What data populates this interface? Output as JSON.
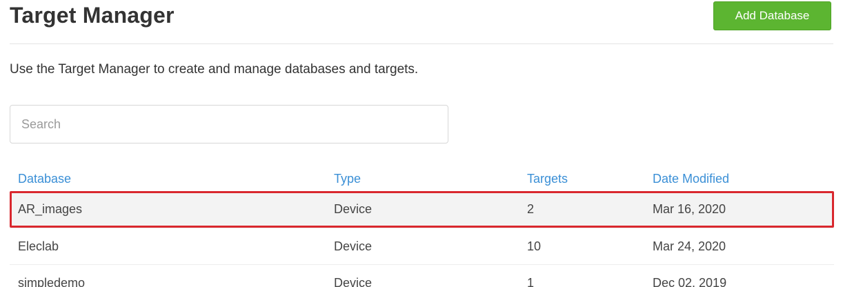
{
  "page": {
    "title": "Target Manager",
    "intro": "Use the Target Manager to create and manage databases and targets."
  },
  "actions": {
    "add_database_label": "Add Database"
  },
  "search": {
    "placeholder": "Search",
    "value": ""
  },
  "table": {
    "columns": {
      "database": "Database",
      "type": "Type",
      "targets": "Targets",
      "date_modified": "Date Modified"
    },
    "rows": [
      {
        "database": "AR_images",
        "type": "Device",
        "targets": "2",
        "date_modified": "Mar 16, 2020",
        "selected": true
      },
      {
        "database": "Eleclab",
        "type": "Device",
        "targets": "10",
        "date_modified": "Mar 24, 2020",
        "selected": false
      },
      {
        "database": "simpledemo",
        "type": "Device",
        "targets": "1",
        "date_modified": "Dec 02, 2019",
        "selected": false
      }
    ]
  },
  "colors": {
    "primary_button": "#5cb531",
    "header_link": "#3a8fd6",
    "selection_outline": "#d9272e"
  }
}
